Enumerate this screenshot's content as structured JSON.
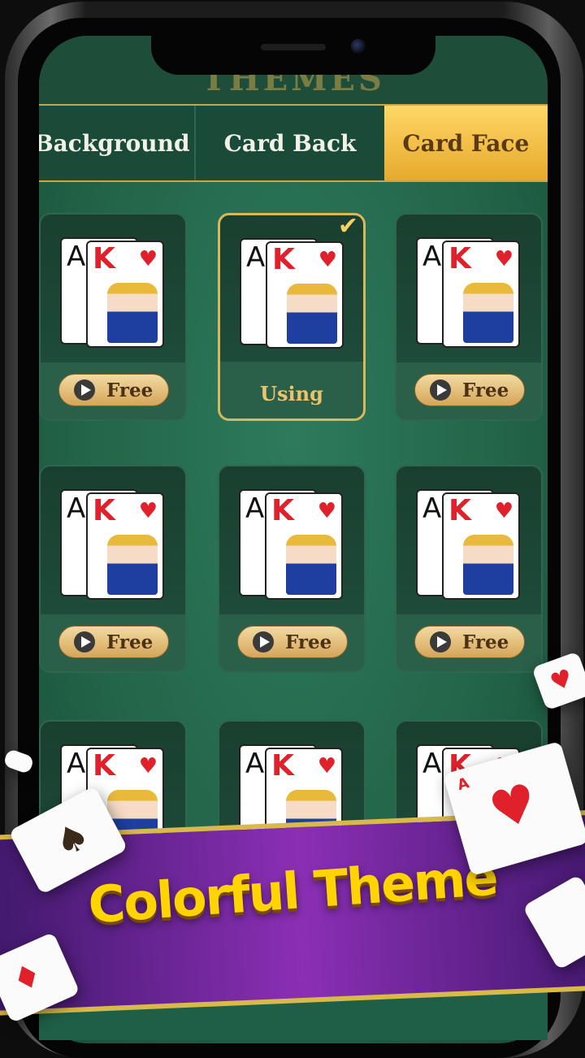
{
  "header": {
    "title": "THEMES"
  },
  "tabs": [
    {
      "label": "Background",
      "active": false
    },
    {
      "label": "Card Back",
      "active": false
    },
    {
      "label": "Card Face",
      "active": true
    }
  ],
  "tiles": [
    {
      "status": "Free",
      "selected": false
    },
    {
      "status": "Using",
      "selected": true
    },
    {
      "status": "Free",
      "selected": false
    },
    {
      "status": "Free",
      "selected": false
    },
    {
      "status": "Free",
      "selected": false
    },
    {
      "status": "Free",
      "selected": false
    },
    {
      "status": "",
      "selected": false
    },
    {
      "status": "",
      "selected": false
    },
    {
      "status": "",
      "selected": false
    }
  ],
  "card_preview": {
    "rank_back": "A",
    "rank_front": "K",
    "suit": "♥"
  },
  "banner": {
    "text": "Colorful Theme"
  },
  "icons": {
    "play": "play-icon",
    "check": "check-icon"
  },
  "colors": {
    "felt": "#226448",
    "gold": "#d9b94a",
    "banner": "#8b2fb5",
    "banner_text": "#ffd400"
  }
}
